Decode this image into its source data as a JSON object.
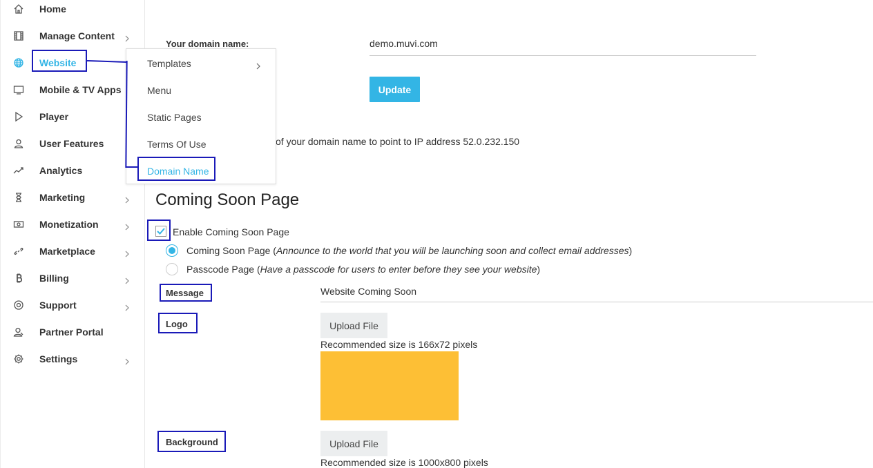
{
  "sidebar": {
    "items": [
      {
        "label": "Home",
        "icon": "home-icon",
        "chevron": false
      },
      {
        "label": "Manage Content",
        "icon": "film-icon",
        "chevron": true
      },
      {
        "label": "Website",
        "icon": "globe-icon",
        "chevron": false,
        "active": true
      },
      {
        "label": "Mobile & TV Apps",
        "icon": "monitor-icon",
        "chevron": false
      },
      {
        "label": "Player",
        "icon": "play-icon",
        "chevron": false
      },
      {
        "label": "User Features",
        "icon": "user-icon",
        "chevron": false
      },
      {
        "label": "Analytics",
        "icon": "trend-icon",
        "chevron": false
      },
      {
        "label": "Marketing",
        "icon": "hourglass-icon",
        "chevron": true
      },
      {
        "label": "Monetization",
        "icon": "money-icon",
        "chevron": true
      },
      {
        "label": "Marketplace",
        "icon": "link-icon",
        "chevron": true
      },
      {
        "label": "Billing",
        "icon": "bitcoin-icon",
        "chevron": true
      },
      {
        "label": "Support",
        "icon": "lifebuoy-icon",
        "chevron": true
      },
      {
        "label": "Partner Portal",
        "icon": "partner-icon",
        "chevron": false
      },
      {
        "label": "Settings",
        "icon": "gear-icon",
        "chevron": true
      }
    ]
  },
  "dropdown": {
    "items": [
      {
        "label": "Templates",
        "chevron": true
      },
      {
        "label": "Menu"
      },
      {
        "label": "Static Pages"
      },
      {
        "label": "Terms Of Use"
      },
      {
        "label": "Domain Name",
        "active": true
      }
    ]
  },
  "domain": {
    "label": "Your domain name:",
    "value": "demo.muvi.com",
    "update_button": "Update",
    "dns_note": "of your domain name to point to IP address 52.0.232.150"
  },
  "coming_soon": {
    "heading": "Coming Soon Page",
    "enable_label": "Enable Coming Soon Page",
    "enable_checked": true,
    "option1_main": "Coming Soon Page (",
    "option1_em": "Announce to the world that you will be launching soon and collect email addresses",
    "option1_end": ")",
    "option2_main": "Passcode Page (",
    "option2_em": "Have a passcode for users to enter before they see your website",
    "option2_end": ")",
    "message_label": "Message",
    "message_value": "Website Coming Soon",
    "logo_label": "Logo",
    "logo_upload": "Upload File",
    "logo_hint": "Recommended size is 166x72 pixels",
    "background_label": "Background",
    "background_upload": "Upload File",
    "background_hint": "Recommended size is 1000x800 pixels"
  },
  "colors": {
    "accent": "#33b5e5",
    "annotation": "#1a1ab8",
    "logo_placeholder": "#fdbf35"
  }
}
